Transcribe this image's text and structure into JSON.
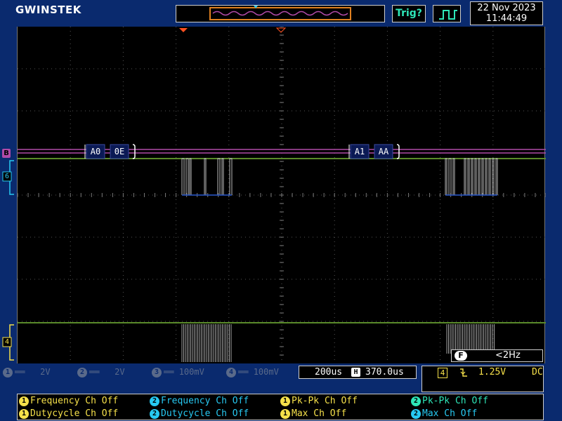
{
  "header": {
    "brand": "GWINSTEK",
    "trig_button_label": "Trig?",
    "wave_button_icon": "square-wave-icon",
    "date": "22 Nov 2023",
    "time": "11:44:49"
  },
  "display": {
    "bus_marker": "B",
    "channel6_marker": "6",
    "channel4_marker": "4",
    "decode_packets": [
      {
        "address": "A0",
        "data": "0E"
      },
      {
        "address": "A1",
        "data": "AA"
      }
    ],
    "frequency_counter": {
      "icon": "F",
      "value": "<2Hz"
    }
  },
  "channel_bar": [
    {
      "num": "1",
      "coupling": "══",
      "scale": "2V"
    },
    {
      "num": "2",
      "coupling": "══",
      "scale": "2V"
    },
    {
      "num": "3",
      "coupling": "══",
      "scale": "100mV"
    },
    {
      "num": "4",
      "coupling": "══",
      "scale": "100mV"
    }
  ],
  "timebase": {
    "scale": "200us",
    "icon": "H",
    "position": "370.0us"
  },
  "trigger": {
    "source": "4",
    "slope_icon": "falling-edge-icon",
    "level": "1.25V",
    "coupling": "DC"
  },
  "measurements": [
    {
      "badge": "1",
      "text": "Frequency Ch Off"
    },
    {
      "badge": "2",
      "text": "Frequency Ch Off"
    },
    {
      "badge": "1",
      "text": "Pk-Pk Ch Off"
    },
    {
      "badge": "2",
      "text": "Pk-Pk Ch Off"
    },
    {
      "badge": "1",
      "text": "Dutycycle Ch Off"
    },
    {
      "badge": "2",
      "text": "Dutycycle Ch Off"
    },
    {
      "badge": "1",
      "text": "Max Ch Off"
    },
    {
      "badge": "2",
      "text": "Max Ch Off"
    }
  ],
  "colors": {
    "background": "#0a2a6e",
    "bus_trace": "#b04aa8",
    "digital_trace": "#5a8a2a",
    "channel6": "#27c9f2",
    "channel4": "#f5e04a",
    "trigger_marker": "#ff5020",
    "measure_ch1": "#f5e04a",
    "measure_ch2": "#27c9f2",
    "measure_pkpk2": "#2ee6b8"
  }
}
